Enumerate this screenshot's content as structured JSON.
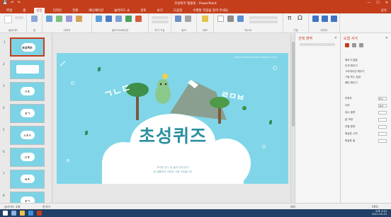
{
  "window": {
    "title": "초성퀴즈 템플릿 - PowerPoint",
    "min": "—",
    "max": "☐",
    "close": "✕"
  },
  "quick_access": [
    "💾",
    "↶",
    "↷"
  ],
  "ribbon": {
    "tabs": [
      "파일",
      "홈",
      "삽입",
      "디자인",
      "전환",
      "애니메이션",
      "슬라이드 쇼",
      "검토",
      "보기",
      "도움말",
      "수행할 작업을 알려 주세요"
    ],
    "active_tab_index": 2,
    "share_label": "공유",
    "groups": [
      "슬라이드",
      "표",
      "이미지",
      "일러스트레이션",
      "추가 기능",
      "링크",
      "메모",
      "텍스트",
      "기호",
      "미디어"
    ]
  },
  "thumbnails": [
    {
      "num": "1",
      "label": "초성퀴즈"
    },
    {
      "num": "2",
      "label": ""
    },
    {
      "num": "3",
      "label": "ㅇㅈ"
    },
    {
      "num": "4",
      "label": "ㅎㄱ"
    },
    {
      "num": "5",
      "label": "ㅅㅊㅇ"
    },
    {
      "num": "6",
      "label": "ㄷㅎ"
    },
    {
      "num": "7",
      "label": "ㅂㅈ"
    },
    {
      "num": "8",
      "label": "ㅊㄱ"
    }
  ],
  "slide": {
    "title": "초성퀴즈",
    "word_left": "ㄱㄴㄷ",
    "word_right": "ㄹㅁㅂ",
    "top_note": "https://www.example-template.com",
    "sub_line1": "저작권 표시 및 출처 안내 문구",
    "sub_line2": "본 템플릿은 무료로 사용 가능합니다"
  },
  "panes": {
    "selection_title": "선택 영역",
    "format_title": "도형 서식",
    "close": "✕",
    "format_rows": [
      {
        "label": "채우기 없음",
        "value": ""
      },
      {
        "label": "단색 채우기",
        "value": ""
      },
      {
        "label": "그라데이션 채우기",
        "value": ""
      },
      {
        "label": "그림 또는 질감",
        "value": ""
      },
      {
        "label": "패턴 채우기",
        "value": ""
      },
      {
        "label": "투명도",
        "value": "0%"
      },
      {
        "label": "너비",
        "value": "1pt"
      },
      {
        "label": "대시 종류",
        "value": ""
      },
      {
        "label": "끝 모양",
        "value": ""
      },
      {
        "label": "연결 종류",
        "value": ""
      },
      {
        "label": "화살표 시작",
        "value": ""
      },
      {
        "label": "화살표 끝",
        "value": ""
      }
    ]
  },
  "status": {
    "slide_info": "슬라이드 1/8",
    "language": "한국어",
    "notes": "메모",
    "zoom": "58%"
  },
  "taskbar": {
    "time": "오후 3:42",
    "date": "2021-03-15"
  },
  "colors": {
    "accent": "#c43e1c",
    "slide_bg": "#80d6e8",
    "title_text": "#2a8fa0"
  }
}
